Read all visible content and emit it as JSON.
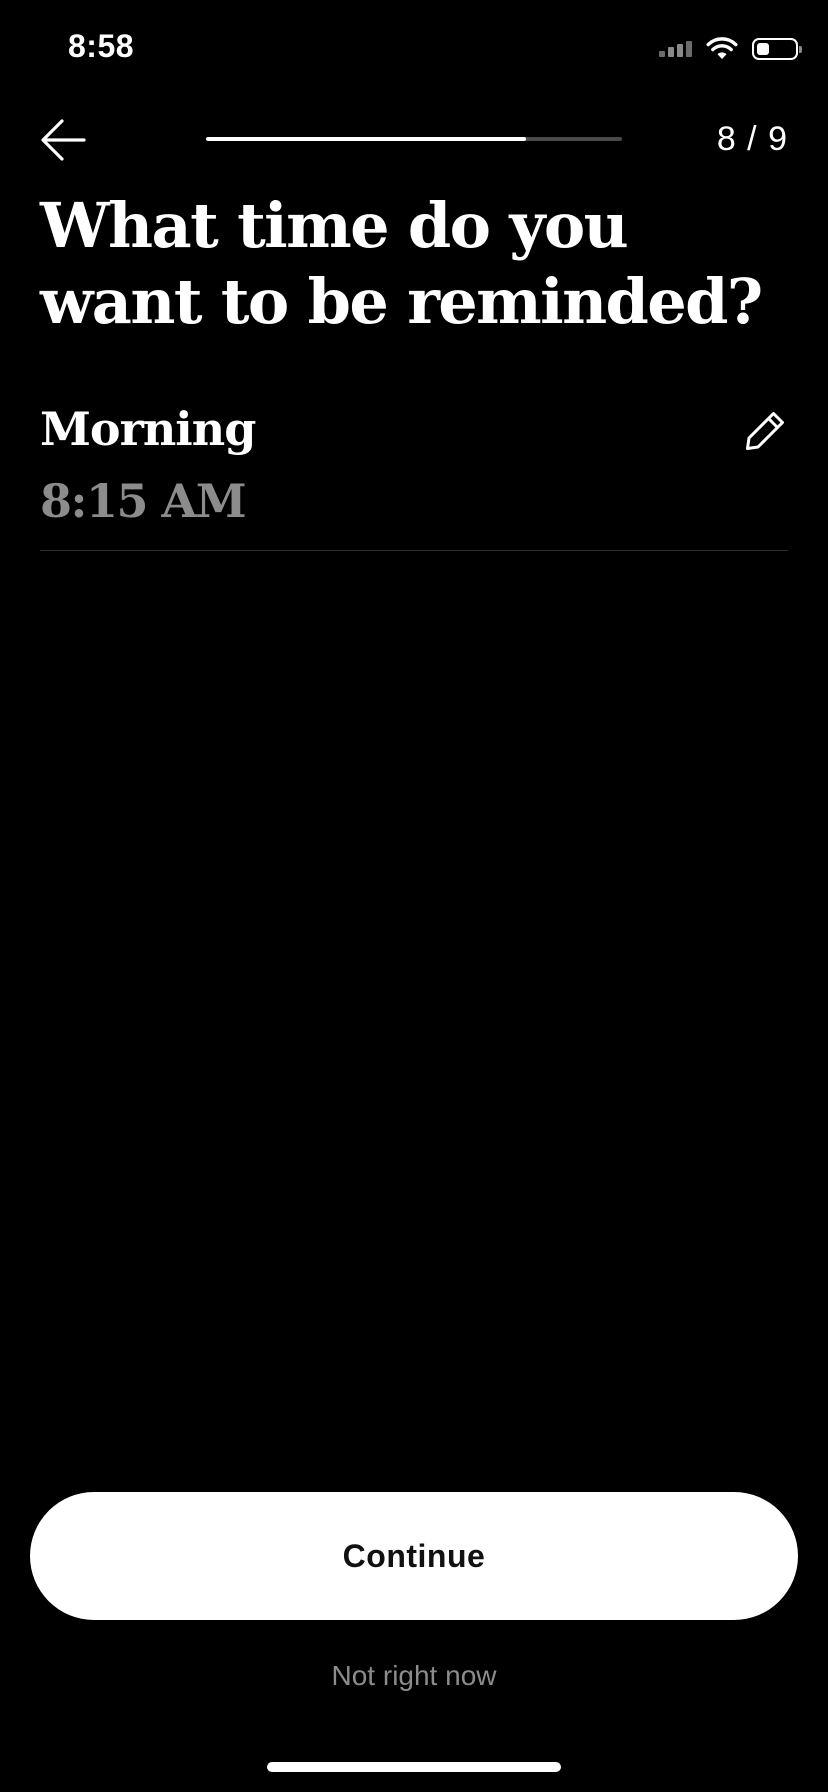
{
  "status_bar": {
    "time": "8:58",
    "icons": [
      "cellular-signal-icon",
      "wifi-icon",
      "battery-icon"
    ],
    "battery_level": 0.25
  },
  "nav": {
    "back_icon": "arrow-left-icon",
    "progress": 0.77,
    "step_counter": "8 / 9"
  },
  "title": "What time do you want to be reminded?",
  "reminder": {
    "label": "Morning",
    "time": "8:15 AM",
    "edit_icon": "pencil-icon"
  },
  "actions": {
    "continue_label": "Continue",
    "skip_label": "Not right now"
  },
  "colors": {
    "background": "#000000",
    "text_primary": "#ffffff",
    "text_secondary": "#8c8c8c",
    "button_bg": "#ffffff",
    "button_text": "#111111"
  }
}
